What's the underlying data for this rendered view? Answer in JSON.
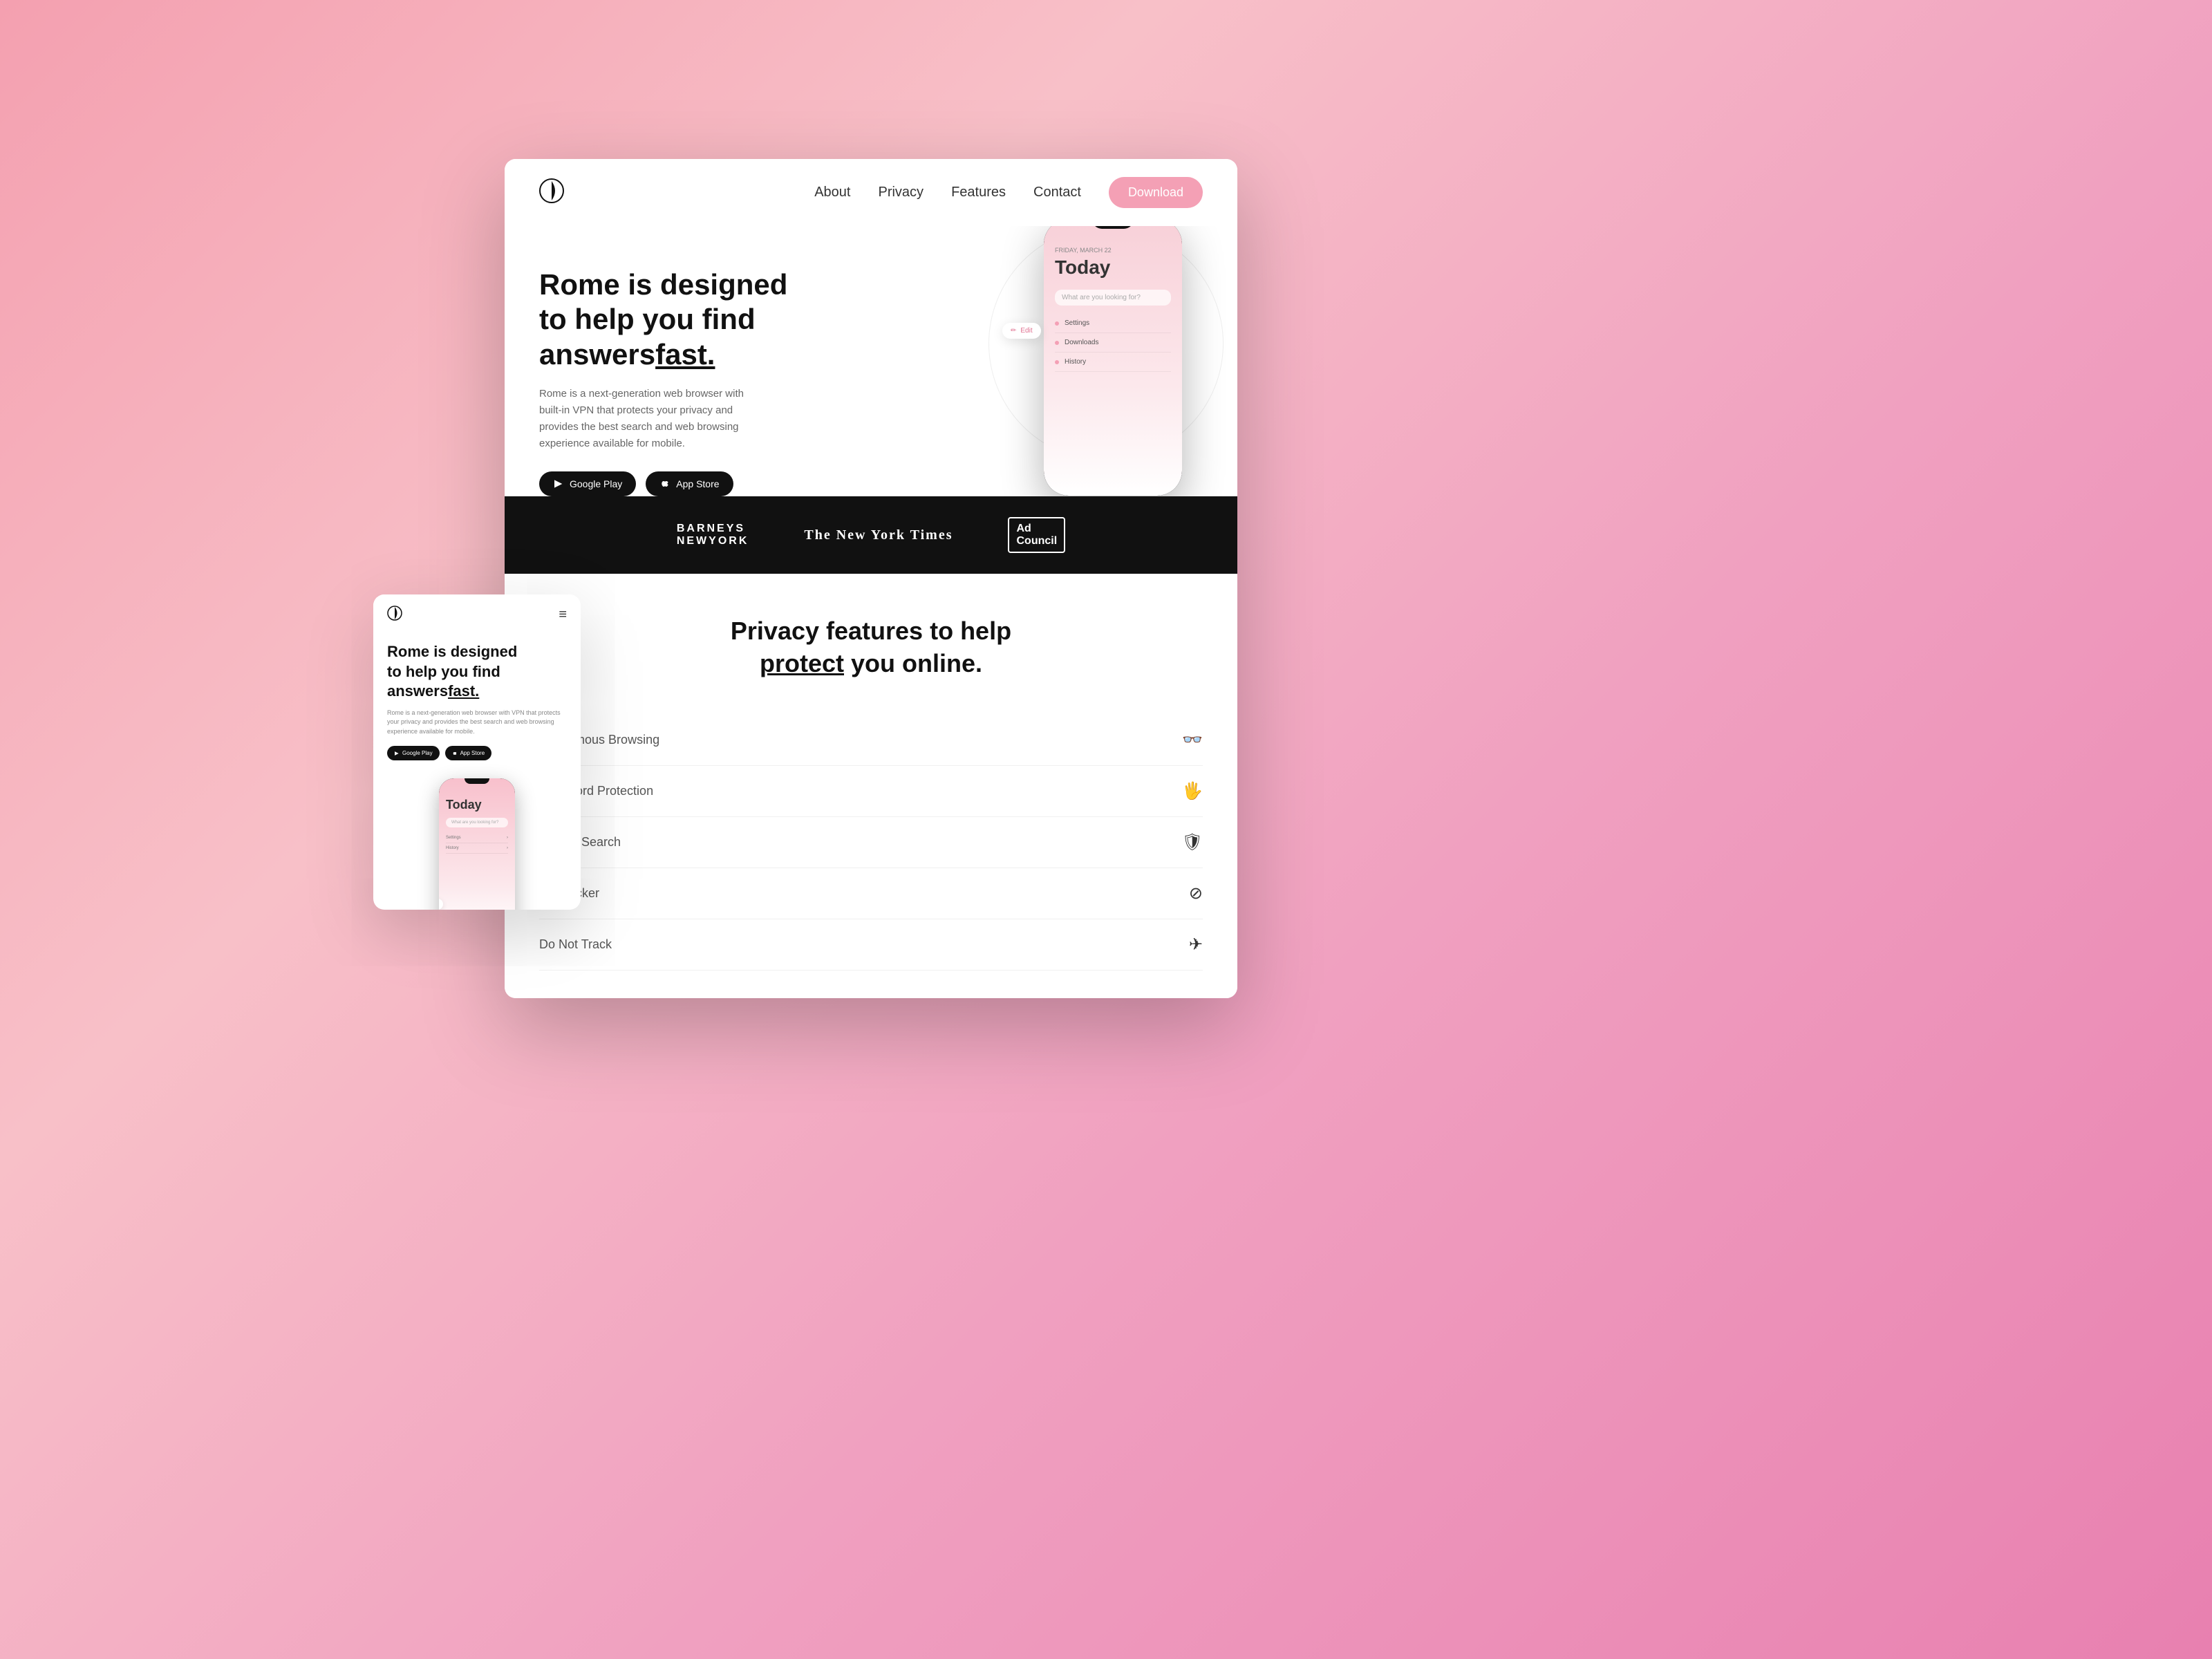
{
  "nav": {
    "logo_symbol": "◑",
    "links": [
      {
        "label": "About",
        "id": "about"
      },
      {
        "label": "Privacy",
        "id": "privacy"
      },
      {
        "label": "Features",
        "id": "features"
      },
      {
        "label": "Contact",
        "id": "contact"
      }
    ],
    "download_label": "Download"
  },
  "hero": {
    "title_line1": "Rome is designed",
    "title_line2": "to help you find",
    "title_line3_normal": "answers",
    "title_line3_highlight": "fast.",
    "description": "Rome is a next-generation web browser with built-in VPN that protects your privacy and provides the best search and web browsing experience available for mobile.",
    "btn_google_play": "Google Play",
    "btn_app_store": "App Store",
    "edit_bubble": "Edit"
  },
  "phone": {
    "date": "FRIDAY, MARCH 22",
    "today_label": "Today",
    "search_placeholder": "What are you looking for?",
    "menu_items": [
      {
        "label": "Settings",
        "icon": "dot"
      },
      {
        "label": "Downloads",
        "icon": "dot"
      },
      {
        "label": "History",
        "icon": "dot"
      }
    ]
  },
  "press_bar": {
    "logos": [
      {
        "label": "BARNEYS\nNEWYORK",
        "style": "sans"
      },
      {
        "label": "The New York Times",
        "style": "serif"
      },
      {
        "label": "Ad\nCouncil",
        "style": "box"
      }
    ]
  },
  "privacy_section": {
    "title_line1": "Privacy features to help",
    "title_line2_normal": "",
    "title_line2_highlight": "protect",
    "title_line2_rest": " you online.",
    "features": [
      {
        "name": "Anonymous Browsing",
        "icon": "👓"
      },
      {
        "name": "Password Protection",
        "icon": "🖐"
      },
      {
        "name": "Private Search",
        "icon": "🛡"
      },
      {
        "name": "Ad Blocker",
        "icon": "⊘"
      },
      {
        "name": "Do Not Track",
        "icon": "✈"
      }
    ]
  },
  "mobile": {
    "hero_title_line1": "Rome is designed",
    "hero_title_line2": "to help you find",
    "hero_title_line3_normal": "answers",
    "hero_title_line3_highlight": "fast.",
    "description": "Rome is a next-generation web browser with VPN that protects your privacy and provides the best search and web browsing experience available for mobile.",
    "btn_google_play": "Google Play",
    "btn_app_store": "App Store"
  },
  "colors": {
    "accent_pink": "#f4a0b5",
    "dark": "#111111",
    "text_muted": "#666666",
    "white": "#ffffff"
  }
}
